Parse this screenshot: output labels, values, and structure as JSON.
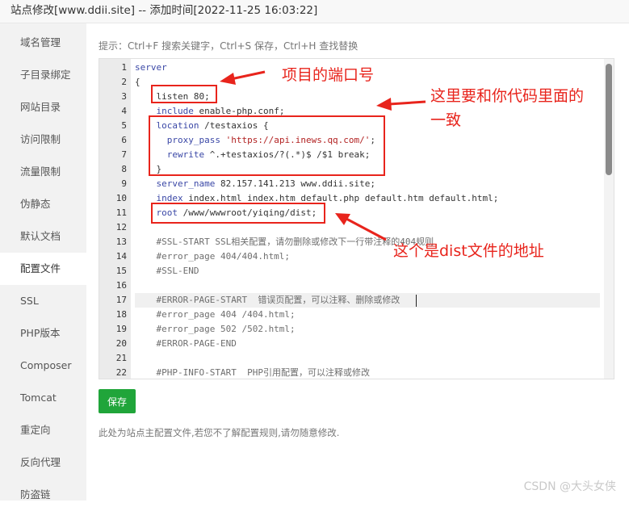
{
  "window": {
    "title": "站点修改[www.ddii.site] -- 添加时间[2022-11-25 16:03:22]"
  },
  "sidebar": {
    "items": [
      {
        "label": "域名管理",
        "active": false
      },
      {
        "label": "子目录绑定",
        "active": false
      },
      {
        "label": "网站目录",
        "active": false
      },
      {
        "label": "访问限制",
        "active": false
      },
      {
        "label": "流量限制",
        "active": false
      },
      {
        "label": "伪静态",
        "active": false
      },
      {
        "label": "默认文档",
        "active": false
      },
      {
        "label": "配置文件",
        "active": true
      },
      {
        "label": "SSL",
        "active": false
      },
      {
        "label": "PHP版本",
        "active": false
      },
      {
        "label": "Composer",
        "active": false
      },
      {
        "label": "Tomcat",
        "active": false
      },
      {
        "label": "重定向",
        "active": false
      },
      {
        "label": "反向代理",
        "active": false
      },
      {
        "label": "防盗链",
        "active": false
      }
    ]
  },
  "editor": {
    "hint": "提示：Ctrl+F 搜索关键字，Ctrl+S 保存，Ctrl+H 查找替换",
    "active_line": 17,
    "lines": [
      {
        "num": "1",
        "tokens": [
          {
            "t": "server",
            "c": "kw"
          }
        ]
      },
      {
        "num": "2",
        "tokens": [
          {
            "t": "{",
            "c": "plain"
          }
        ]
      },
      {
        "num": "3",
        "tokens": [
          {
            "t": "    ",
            "c": "plain"
          },
          {
            "t": "listen 80;",
            "c": "plain"
          }
        ]
      },
      {
        "num": "4",
        "tokens": [
          {
            "t": "    ",
            "c": "plain"
          },
          {
            "t": "include",
            "c": "kw"
          },
          {
            "t": " enable-php.conf;",
            "c": "plain"
          }
        ]
      },
      {
        "num": "5",
        "tokens": [
          {
            "t": "    ",
            "c": "plain"
          },
          {
            "t": "location",
            "c": "kw"
          },
          {
            "t": " /testaxios {",
            "c": "plain"
          }
        ]
      },
      {
        "num": "6",
        "tokens": [
          {
            "t": "      ",
            "c": "plain"
          },
          {
            "t": "proxy_pass",
            "c": "kw"
          },
          {
            "t": " ",
            "c": "plain"
          },
          {
            "t": "'https://api.inews.qq.com/'",
            "c": "str"
          },
          {
            "t": ";",
            "c": "plain"
          }
        ]
      },
      {
        "num": "7",
        "tokens": [
          {
            "t": "      ",
            "c": "plain"
          },
          {
            "t": "rewrite",
            "c": "kw"
          },
          {
            "t": " ^.+testaxios/?(.*)$ /$1 break;",
            "c": "plain"
          }
        ]
      },
      {
        "num": "8",
        "tokens": [
          {
            "t": "    }",
            "c": "plain"
          }
        ]
      },
      {
        "num": "9",
        "tokens": [
          {
            "t": "    ",
            "c": "plain"
          },
          {
            "t": "server_name",
            "c": "kw"
          },
          {
            "t": " 82.157.141.213 www.ddii.site;",
            "c": "plain"
          }
        ]
      },
      {
        "num": "10",
        "tokens": [
          {
            "t": "    ",
            "c": "plain"
          },
          {
            "t": "index",
            "c": "kw"
          },
          {
            "t": " index.html index.htm default.php default.htm default.html;",
            "c": "plain"
          }
        ]
      },
      {
        "num": "11",
        "tokens": [
          {
            "t": "    ",
            "c": "plain"
          },
          {
            "t": "root",
            "c": "kw"
          },
          {
            "t": " /www/wwwroot/yiqing/dist;",
            "c": "plain"
          }
        ]
      },
      {
        "num": "12",
        "tokens": []
      },
      {
        "num": "13",
        "tokens": [
          {
            "t": "    #SSL-START SSL相关配置，请勿删除或修改下一行带注释的404规则",
            "c": "cm"
          }
        ]
      },
      {
        "num": "14",
        "tokens": [
          {
            "t": "    #error_page 404/404.html;",
            "c": "cm"
          }
        ]
      },
      {
        "num": "15",
        "tokens": [
          {
            "t": "    #SSL-END",
            "c": "cm"
          }
        ]
      },
      {
        "num": "16",
        "tokens": []
      },
      {
        "num": "17",
        "tokens": [
          {
            "t": "    #ERROR-PAGE-START  错误页配置，可以注释、删除或修改",
            "c": "cm"
          }
        ]
      },
      {
        "num": "18",
        "tokens": [
          {
            "t": "    #error_page 404 /404.html;",
            "c": "cm"
          }
        ]
      },
      {
        "num": "19",
        "tokens": [
          {
            "t": "    #error_page 502 /502.html;",
            "c": "cm"
          }
        ]
      },
      {
        "num": "20",
        "tokens": [
          {
            "t": "    #ERROR-PAGE-END",
            "c": "cm"
          }
        ]
      },
      {
        "num": "21",
        "tokens": []
      },
      {
        "num": "22",
        "tokens": [
          {
            "t": "    #PHP-INFO-START  PHP引用配置，可以注释或修改",
            "c": "cm"
          }
        ]
      }
    ]
  },
  "actions": {
    "save_label": "保存"
  },
  "footer": {
    "note": "此处为站点主配置文件,若您不了解配置规则,请勿随意修改."
  },
  "annotations": {
    "port_label": "项目的端口号",
    "consistent_label_line1": "这里要和你代码里面的",
    "consistent_label_line2": "一致",
    "dist_label": "这个是dist文件的地址",
    "color": "#e8241c"
  },
  "watermark": "CSDN @大头女侠",
  "colors": {
    "accent": "#20a53a",
    "keyword": "#3a47a6",
    "string": "#b22222",
    "comment": "#6e6e6e"
  }
}
